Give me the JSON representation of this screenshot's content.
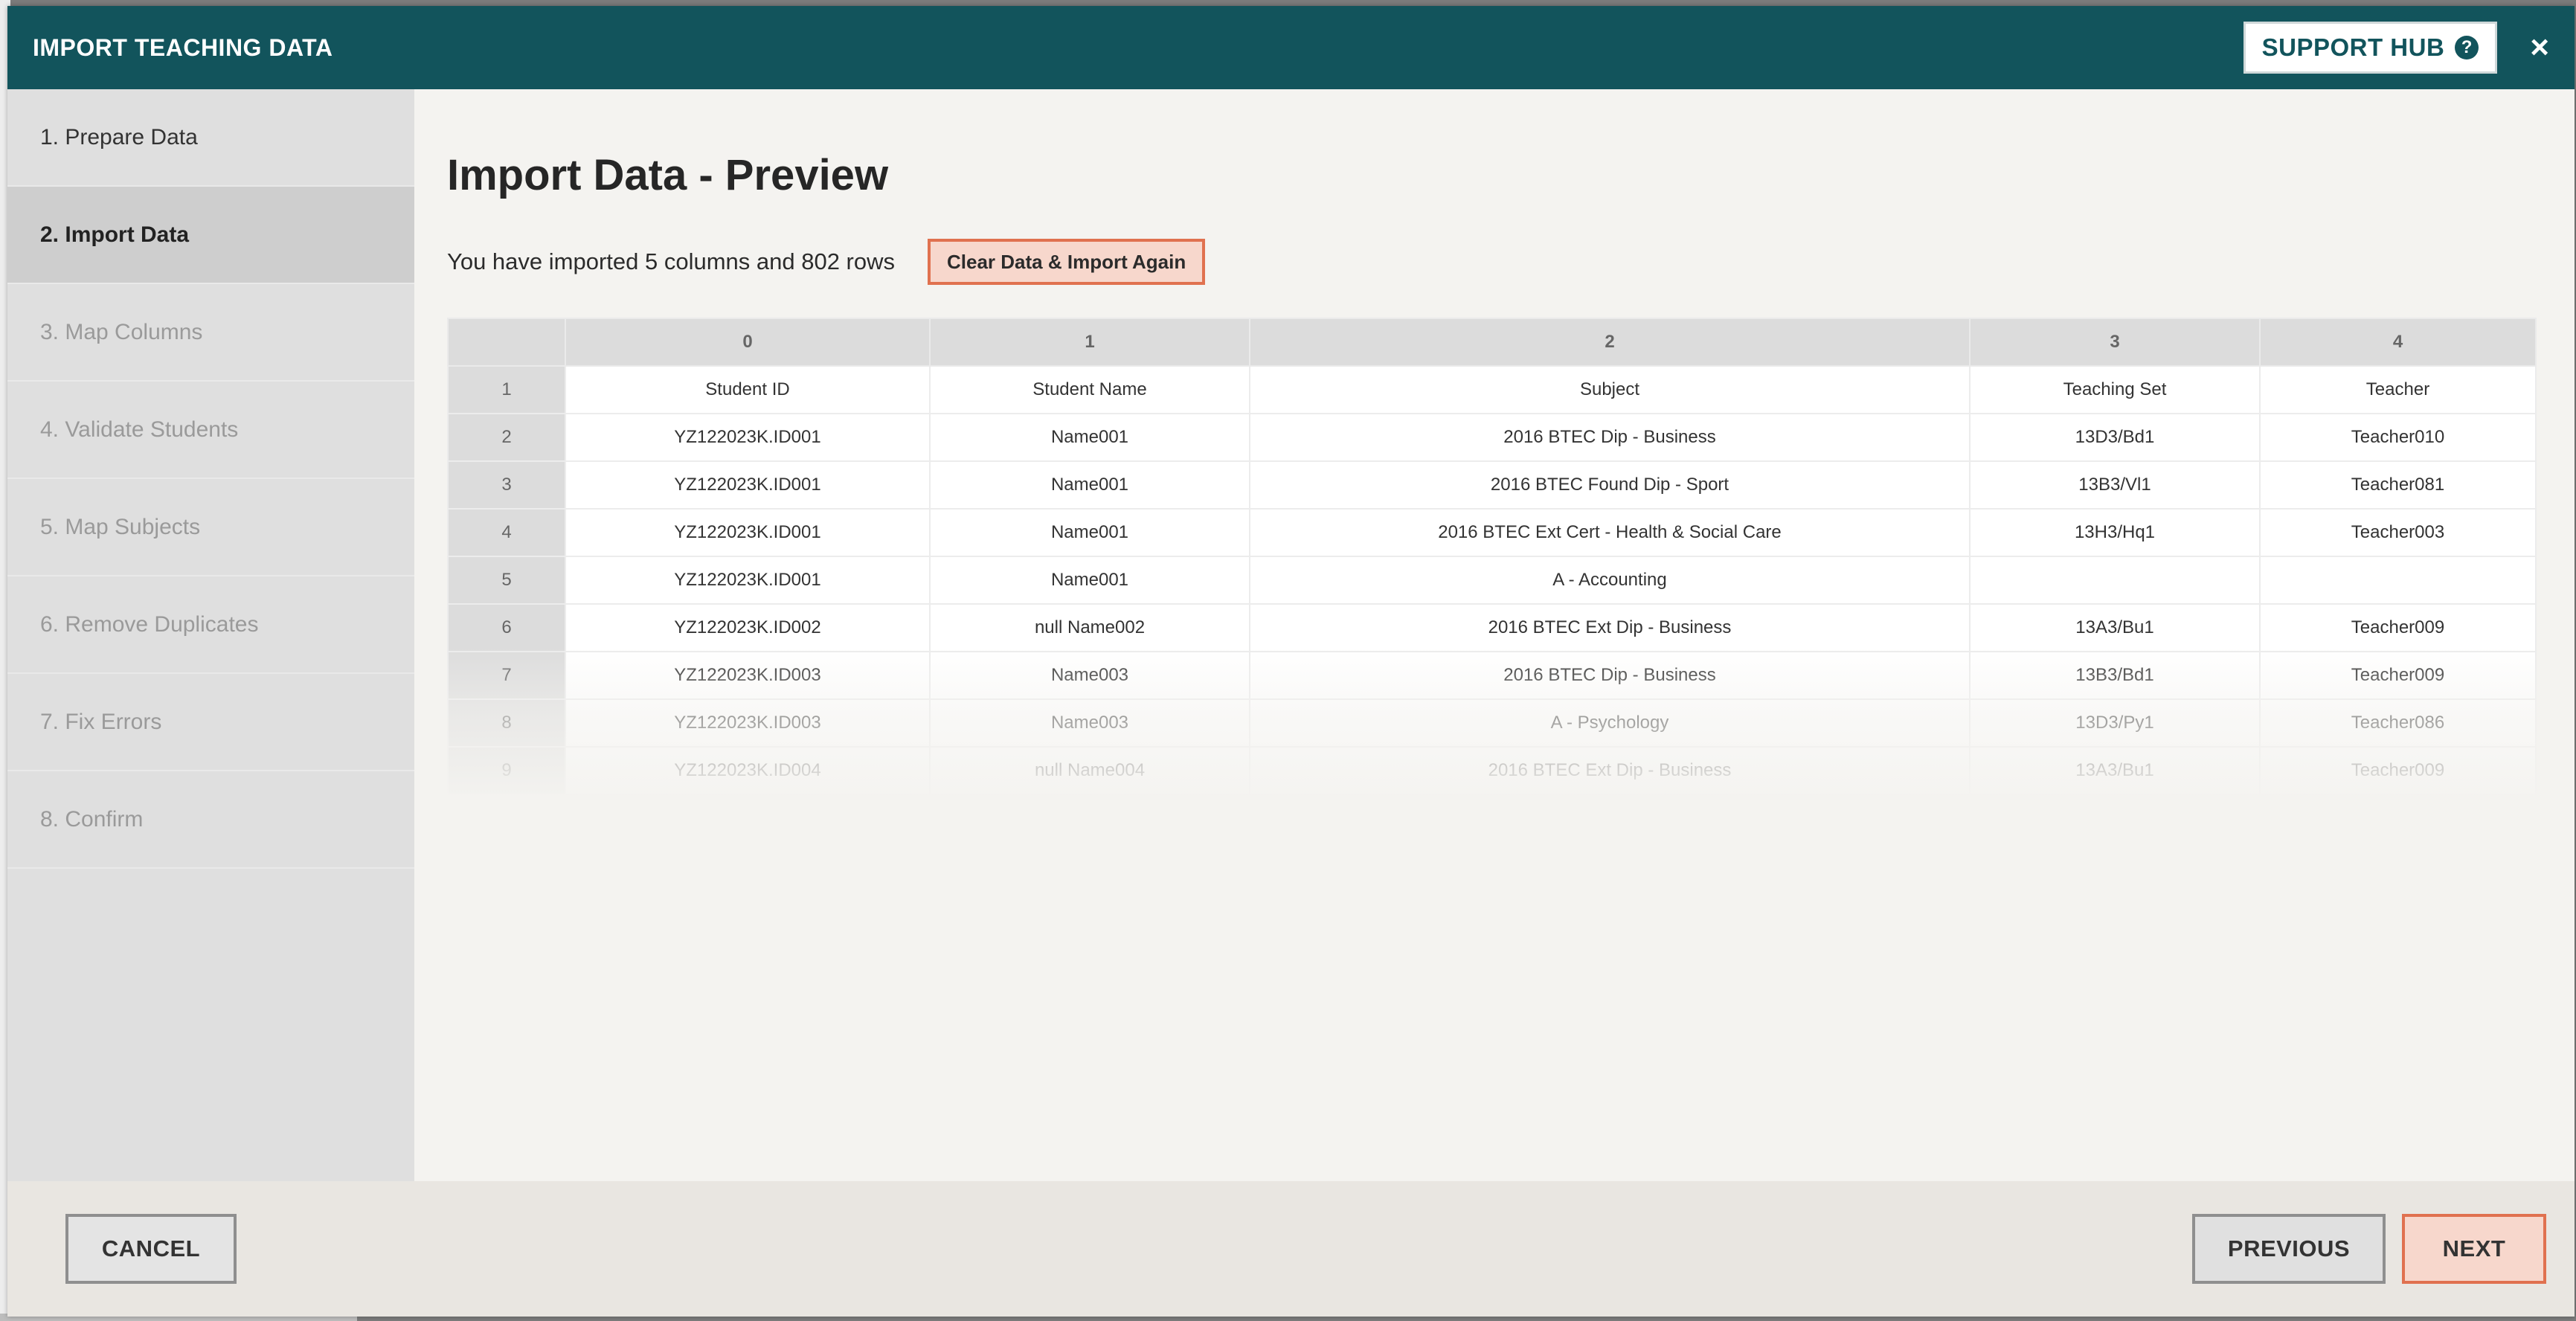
{
  "modal": {
    "title": "IMPORT TEACHING DATA",
    "support_label": "SUPPORT HUB",
    "help_icon_glyph": "?",
    "close_glyph": "×",
    "brand_color": "#12545c",
    "accent_color": "#e0714f"
  },
  "sidebar": {
    "steps": [
      {
        "label": "1. Prepare Data",
        "state": "done"
      },
      {
        "label": "2. Import Data",
        "state": "active"
      },
      {
        "label": "3. Map Columns",
        "state": "pending"
      },
      {
        "label": "4. Validate Students",
        "state": "pending"
      },
      {
        "label": "5. Map Subjects",
        "state": "pending"
      },
      {
        "label": "6. Remove Duplicates",
        "state": "pending"
      },
      {
        "label": "7. Fix Errors",
        "state": "pending"
      },
      {
        "label": "8. Confirm",
        "state": "pending"
      }
    ]
  },
  "main": {
    "title": "Import Data - Preview",
    "summary": "You have imported 5 columns and 802 rows",
    "clear_label": "Clear Data & Import Again"
  },
  "preview": {
    "columns": [
      "0",
      "1",
      "2",
      "3",
      "4"
    ],
    "rows": [
      {
        "num": "1",
        "cells": [
          "Student ID",
          "Student Name",
          "Subject",
          "Teaching Set",
          "Teacher"
        ]
      },
      {
        "num": "2",
        "cells": [
          "YZ122023K.ID001",
          "Name001",
          "2016 BTEC Dip - Business",
          "13D3/Bd1",
          "Teacher010"
        ]
      },
      {
        "num": "3",
        "cells": [
          "YZ122023K.ID001",
          "Name001",
          "2016 BTEC Found Dip - Sport",
          "13B3/Vl1",
          "Teacher081"
        ]
      },
      {
        "num": "4",
        "cells": [
          "YZ122023K.ID001",
          "Name001",
          "2016 BTEC Ext Cert - Health & Social Care",
          "13H3/Hq1",
          "Teacher003"
        ]
      },
      {
        "num": "5",
        "cells": [
          "YZ122023K.ID001",
          "Name001",
          "A - Accounting",
          "",
          ""
        ]
      },
      {
        "num": "6",
        "cells": [
          "YZ122023K.ID002",
          "null Name002",
          "2016 BTEC Ext Dip - Business",
          "13A3/Bu1",
          "Teacher009"
        ]
      },
      {
        "num": "7",
        "cells": [
          "YZ122023K.ID003",
          "Name003",
          "2016 BTEC Dip - Business",
          "13B3/Bd1",
          "Teacher009"
        ]
      },
      {
        "num": "8",
        "cells": [
          "YZ122023K.ID003",
          "Name003",
          "A - Psychology",
          "13D3/Py1",
          "Teacher086"
        ]
      },
      {
        "num": "9",
        "cells": [
          "YZ122023K.ID004",
          "null Name004",
          "2016 BTEC Ext Dip - Business",
          "13A3/Bu1",
          "Teacher009"
        ]
      }
    ]
  },
  "footer": {
    "cancel_label": "CANCEL",
    "previous_label": "PREVIOUS",
    "next_label": "NEXT"
  }
}
